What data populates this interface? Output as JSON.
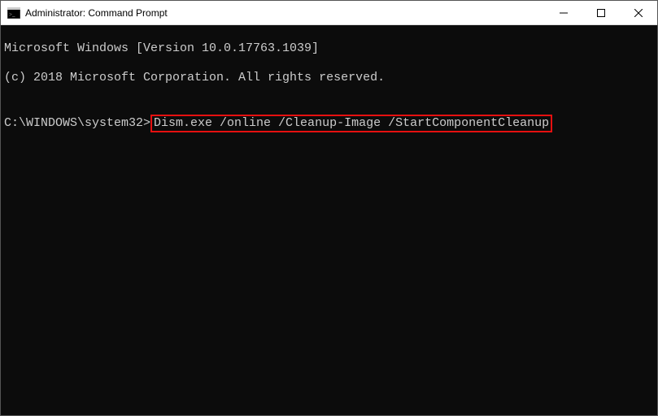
{
  "window": {
    "title": "Administrator: Command Prompt"
  },
  "terminal": {
    "line1": "Microsoft Windows [Version 10.0.17763.1039]",
    "line2": "(c) 2018 Microsoft Corporation. All rights reserved.",
    "blank": "",
    "prompt": "C:\\WINDOWS\\system32>",
    "command": "Dism.exe /online /Cleanup-Image /StartComponentCleanup"
  }
}
